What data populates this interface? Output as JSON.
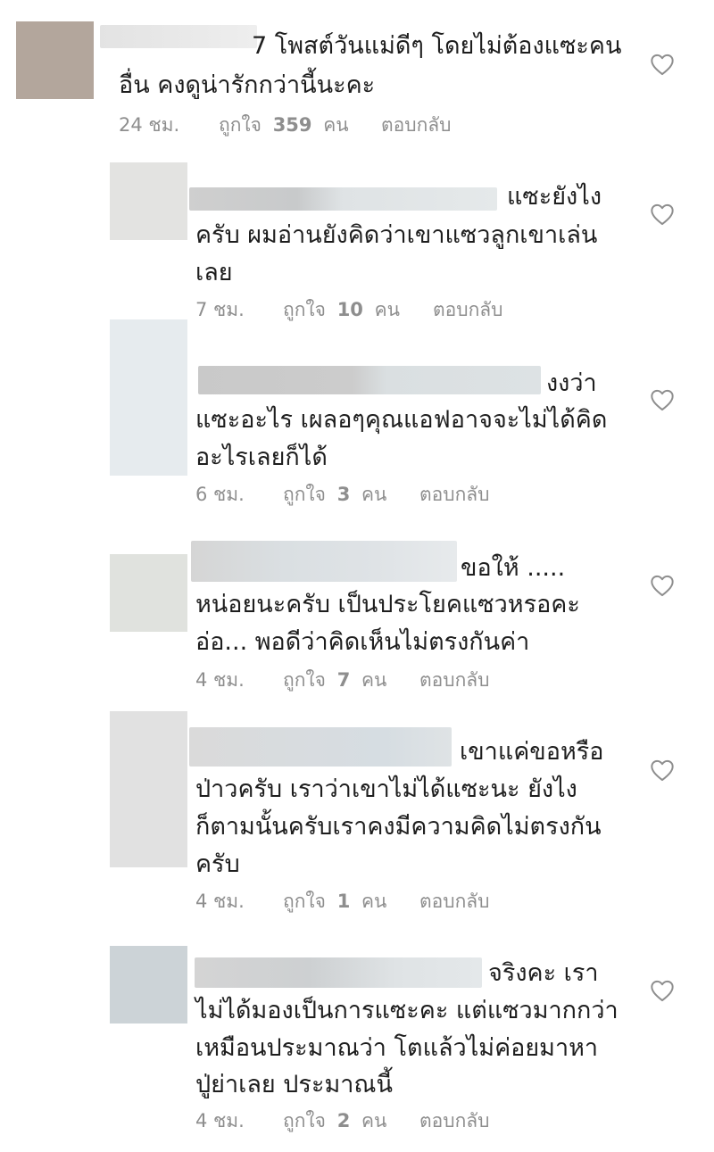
{
  "comments": [
    {
      "lines": [
        "7 โพสต์วันแม่ดีๆ โดยไม่ต้องแซะคน",
        "อื่น คงดูน่ารักกว่านี้นะคะ"
      ],
      "time": "24 ชม.",
      "likes_prefix": "ถูกใจ",
      "likes_count": "359",
      "likes_suffix": "คน",
      "reply": "ตอบกลับ",
      "avatar_color": "#b3a69c"
    },
    {
      "lines": [
        "แซะยังไง",
        "ครับ ผมอ่านยังคิดว่าเขาแซวลูกเขาเล่น",
        "เลย"
      ],
      "time": "7 ชม.",
      "likes_prefix": "ถูกใจ",
      "likes_count": "10",
      "likes_suffix": "คน",
      "reply": "ตอบกลับ",
      "avatar_color": "#e3e3e1"
    },
    {
      "lines": [
        "งงว่า",
        "แซะอะไร เผลอๆคุณแอฟอาจจะไม่ได้คิด",
        "อะไรเลยก็ได้"
      ],
      "time": "6 ชม.",
      "likes_prefix": "ถูกใจ",
      "likes_count": "3",
      "likes_suffix": "คน",
      "reply": "ตอบกลับ",
      "avatar_color": "#e6ebee"
    },
    {
      "lines": [
        "ขอให้ .....",
        "หน่อยนะครับ เป็นประโยคแซวหรอคะ",
        "อ่อ... พอดีว่าคิดเห็นไม่ตรงกันค่า"
      ],
      "time": "4 ชม.",
      "likes_prefix": "ถูกใจ",
      "likes_count": "7",
      "likes_suffix": "คน",
      "reply": "ตอบกลับ",
      "avatar_color": "#e0e2de"
    },
    {
      "lines": [
        "เขาแค่ขอหรือ",
        "ป่าวครับ เราว่าเขาไม่ได้แซะนะ ยังไง",
        "ก็ตามนั้นครับเราคงมีความคิดไม่ตรงกัน",
        "ครับ"
      ],
      "time": "4 ชม.",
      "likes_prefix": "ถูกใจ",
      "likes_count": "1",
      "likes_suffix": "คน",
      "reply": "ตอบกลับ",
      "avatar_color": "#e1e1e1"
    },
    {
      "lines": [
        "จริงคะ เรา",
        "ไม่ได้มองเป็นการแซะคะ แต่แซวมากกว่า",
        "เหมือนประมาณว่า โตแล้วไม่ค่อยมาหา",
        "ปู่ย่าเลย ประมาณนี้"
      ],
      "time": "4 ชม.",
      "likes_prefix": "ถูกใจ",
      "likes_count": "2",
      "likes_suffix": "คน",
      "reply": "ตอบกลับ",
      "avatar_color": "#ccd3d7"
    }
  ],
  "icons": {
    "like": "heart-outline-icon"
  },
  "colors": {
    "text": "#1e1e1e",
    "meta": "#8e8e8e",
    "heart": "#8e8e8e"
  }
}
